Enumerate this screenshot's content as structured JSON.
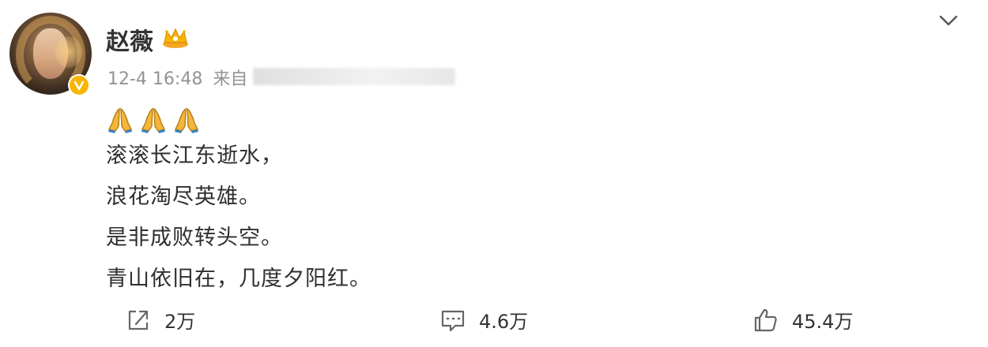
{
  "user": {
    "name": "赵薇",
    "badge_icon": "crown-icon",
    "verified_icon": "verified-v-icon"
  },
  "post": {
    "timestamp": "12-4 16:48",
    "source_prefix": "来自",
    "emojis": [
      "🙏",
      "🙏",
      "🙏"
    ],
    "lines": [
      "滚滚长江东逝水，",
      "浪花淘尽英雄。",
      "是非成败转头空。",
      "青山依旧在，几度夕阳红。"
    ]
  },
  "actions": {
    "repost": {
      "icon": "repost-icon",
      "count": "2万"
    },
    "comment": {
      "icon": "comment-icon",
      "count": "4.6万"
    },
    "like": {
      "icon": "thumbs-up-icon",
      "count": "45.4万"
    }
  },
  "menu": {
    "icon": "chevron-down-icon"
  },
  "colors": {
    "meta": "#939393",
    "text": "#2f2f2f",
    "badge": "#f7b500"
  }
}
